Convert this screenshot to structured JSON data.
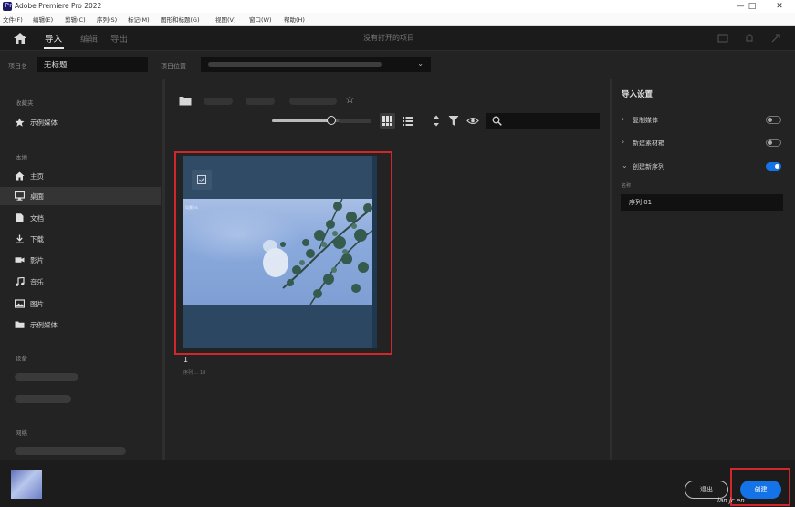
{
  "window": {
    "title": "Adobe Premiere Pro 2022",
    "controls": [
      "—",
      "□",
      "✕"
    ]
  },
  "menubar": {
    "items": [
      "文件(F)",
      "编辑(E)",
      "剪辑(C)",
      "序列(S)",
      "标记(M)",
      "图形和标题(G)",
      "视图(V)",
      "窗口(W)",
      "帮助(H)"
    ]
  },
  "header": {
    "tabs": [
      {
        "label": "导入",
        "active": true
      },
      {
        "label": "编辑",
        "active": false
      },
      {
        "label": "导出",
        "active": false
      }
    ],
    "project_title": "没有打开的项目"
  },
  "project": {
    "name_label": "项目名",
    "name_value": "无标题",
    "location_label": "项目位置"
  },
  "sidebar": {
    "sections": [
      {
        "heading": "收藏夹",
        "items": [
          {
            "label": "示例媒体",
            "icon": "star-icon"
          }
        ]
      },
      {
        "heading": "本地",
        "items": [
          {
            "label": "主页",
            "icon": "home-icon"
          },
          {
            "label": "桌面",
            "icon": "desktop-icon",
            "selected": true
          },
          {
            "label": "文档",
            "icon": "document-icon"
          },
          {
            "label": "下载",
            "icon": "download-icon"
          },
          {
            "label": "影片",
            "icon": "video-icon"
          },
          {
            "label": "音乐",
            "icon": "music-icon"
          },
          {
            "label": "图片",
            "icon": "image-icon"
          },
          {
            "label": "示例媒体",
            "icon": "folder-icon"
          }
        ]
      },
      {
        "heading": "设备",
        "items": []
      },
      {
        "heading": "网络",
        "items": []
      }
    ]
  },
  "browser": {
    "search_placeholder": "",
    "zoom_level": 0.6,
    "view_mode": "grid",
    "clip": {
      "name": "1",
      "meta": "序列 ... 18",
      "selected": true,
      "thumb_text": "风景ins"
    }
  },
  "import_settings": {
    "title": "导入设置",
    "options": [
      {
        "label": "复制媒体",
        "expanded": false,
        "enabled": false
      },
      {
        "label": "新建素材箱",
        "expanded": false,
        "enabled": false
      },
      {
        "label": "创建新序列",
        "expanded": true,
        "enabled": true
      }
    ],
    "sequence_name_label": "名称",
    "sequence_name_value": "序列 01"
  },
  "footer": {
    "exit_label": "退出",
    "create_label": "创建"
  },
  "watermark": "lan jc.en",
  "colors": {
    "accent": "#1473e6",
    "highlight": "#d1262a",
    "background": "#232323",
    "card": "#2f4b66"
  }
}
